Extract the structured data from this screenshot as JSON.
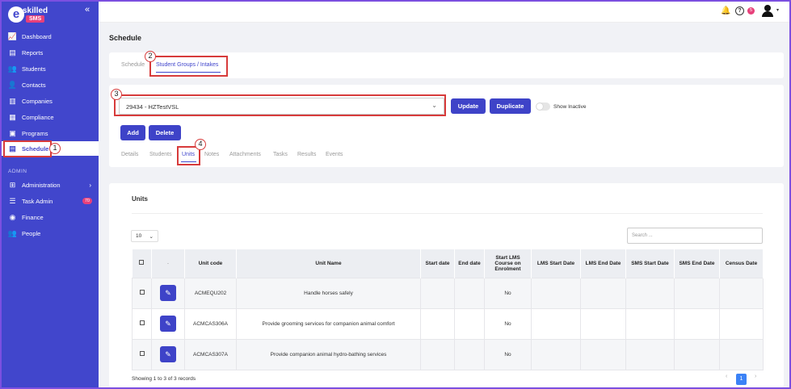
{
  "logo": {
    "e": "e",
    "skilled": "skilled",
    "sms": "SMS"
  },
  "sidebar": {
    "collapse": "«",
    "items": [
      {
        "label": "Dashboard",
        "icon": "chart-line-icon",
        "glyph": "📈"
      },
      {
        "label": "Reports",
        "icon": "report-icon",
        "glyph": "▤"
      },
      {
        "label": "Students",
        "icon": "users-icon",
        "glyph": "👥"
      },
      {
        "label": "Contacts",
        "icon": "contact-icon",
        "glyph": "👤"
      },
      {
        "label": "Companies",
        "icon": "building-icon",
        "glyph": "▥"
      },
      {
        "label": "Compliance",
        "icon": "clipboard-icon",
        "glyph": "▦"
      },
      {
        "label": "Programs",
        "icon": "folder-icon",
        "glyph": "▣"
      },
      {
        "label": "Schedule",
        "icon": "calendar-icon",
        "glyph": "▤"
      }
    ],
    "admin_header": "ADMIN",
    "admin_items": [
      {
        "label": "Administration",
        "icon": "grid-icon",
        "glyph": "⊞"
      },
      {
        "label": "Task Admin",
        "icon": "list-icon",
        "glyph": "☰",
        "badge": "70"
      },
      {
        "label": "Finance",
        "icon": "coins-icon",
        "glyph": "◉"
      },
      {
        "label": "People",
        "icon": "people-icon",
        "glyph": "👥"
      }
    ]
  },
  "topbar": {
    "notif_count": "5",
    "help": "?",
    "caret": "▾"
  },
  "page_title": "Schedule",
  "top_tabs": [
    "Schedule",
    "Student Groups / Intakes"
  ],
  "intake_select": {
    "value": "29434 - HZTestVSL",
    "chevron": "⌄"
  },
  "buttons": {
    "update": "Update",
    "duplicate": "Duplicate",
    "add": "Add",
    "delete": "Delete"
  },
  "toggle_label": "Show Inactive",
  "detail_tabs": [
    "Details",
    "Students",
    "Units",
    "Notes",
    "Attachments",
    "Tasks",
    "Results",
    "Events"
  ],
  "annotations": [
    "1",
    "2",
    "3",
    "4"
  ],
  "units_section": {
    "title": "Units",
    "page_length": "10",
    "search_placeholder": "Search ...",
    "columns": [
      "",
      "-",
      "Unit code",
      "Unit Name",
      "Start date",
      "End date",
      "Start LMS Course on Enrolment",
      "LMS Start Date",
      "LMS End Date",
      "SMS Start Date",
      "SMS End Date",
      "Census Date"
    ],
    "rows": [
      {
        "code": "ACMEQU202",
        "name": "Handle horses safely",
        "lms_start": "No"
      },
      {
        "code": "ACMCAS306A",
        "name": "Provide grooming services for companion animal comfort",
        "lms_start": "No"
      },
      {
        "code": "ACMCAS307A",
        "name": "Provide companion animal hydro-bathing services",
        "lms_start": "No"
      }
    ],
    "footer": "Showing 1 to 3 of 3 records",
    "current_page": "1",
    "prev": "‹",
    "next": "›"
  },
  "colors": {
    "sidebar": "#4146cc",
    "accent": "#3e43c8",
    "badge": "#e7407a",
    "annotation": "#d73b3b"
  }
}
